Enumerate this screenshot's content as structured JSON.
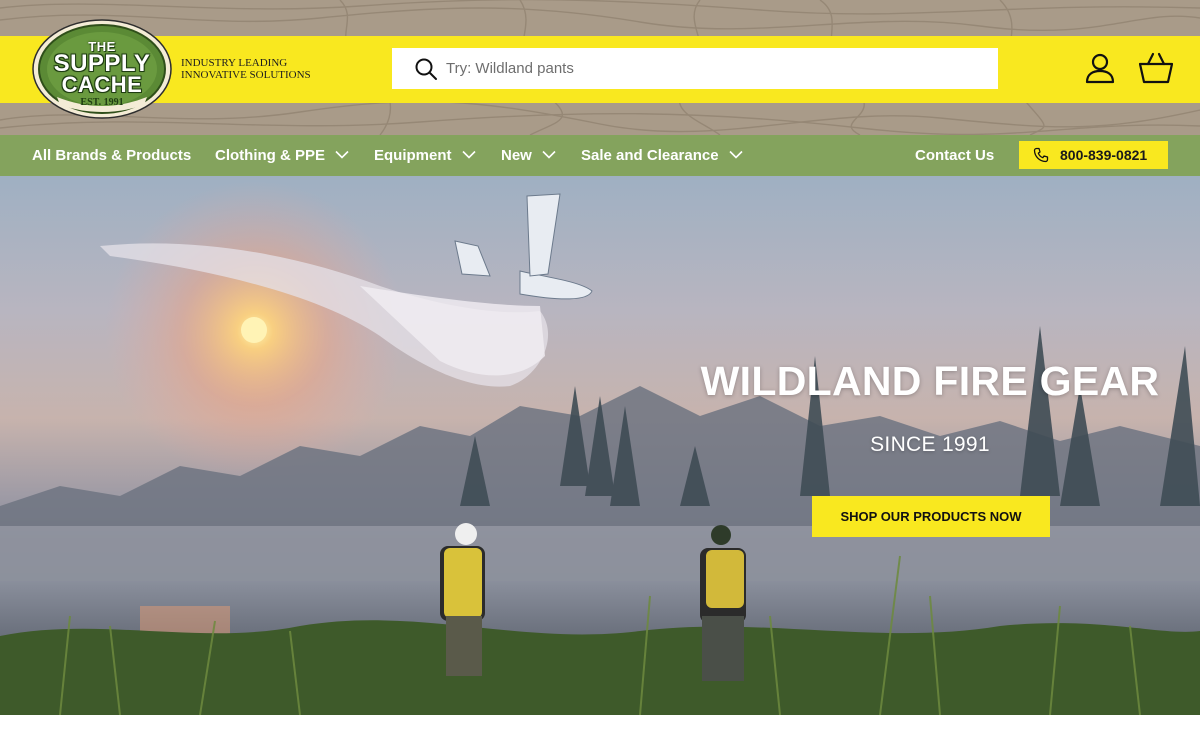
{
  "brand": {
    "logo_the": "THE",
    "logo_supply": "SUPPLY",
    "logo_cache": "CACHE",
    "logo_est": "EST. 1991",
    "tagline_line1": "INDUSTRY LEADING",
    "tagline_line2": "INNOVATIVE SOLUTIONS"
  },
  "search": {
    "placeholder": "Try: Wildland pants",
    "value": ""
  },
  "header_icons": {
    "account": "account-icon",
    "cart": "cart-icon"
  },
  "nav": {
    "items": [
      {
        "label": "All Brands & Products",
        "has_dropdown": false
      },
      {
        "label": "Clothing & PPE",
        "has_dropdown": true
      },
      {
        "label": "Equipment",
        "has_dropdown": true
      },
      {
        "label": "New",
        "has_dropdown": true
      },
      {
        "label": "Sale and Clearance",
        "has_dropdown": true
      }
    ],
    "contact": "Contact Us",
    "phone": "800-839-0821"
  },
  "hero": {
    "title": "WILDLAND FIRE GEAR",
    "subtitle": "SINCE 1991",
    "cta": "SHOP OUR PRODUCTS NOW"
  },
  "colors": {
    "header_yellow": "#f9e81f",
    "nav_green": "#84a35d",
    "topo_brown": "#a99b89",
    "logo_green": "#4e7a2f"
  }
}
